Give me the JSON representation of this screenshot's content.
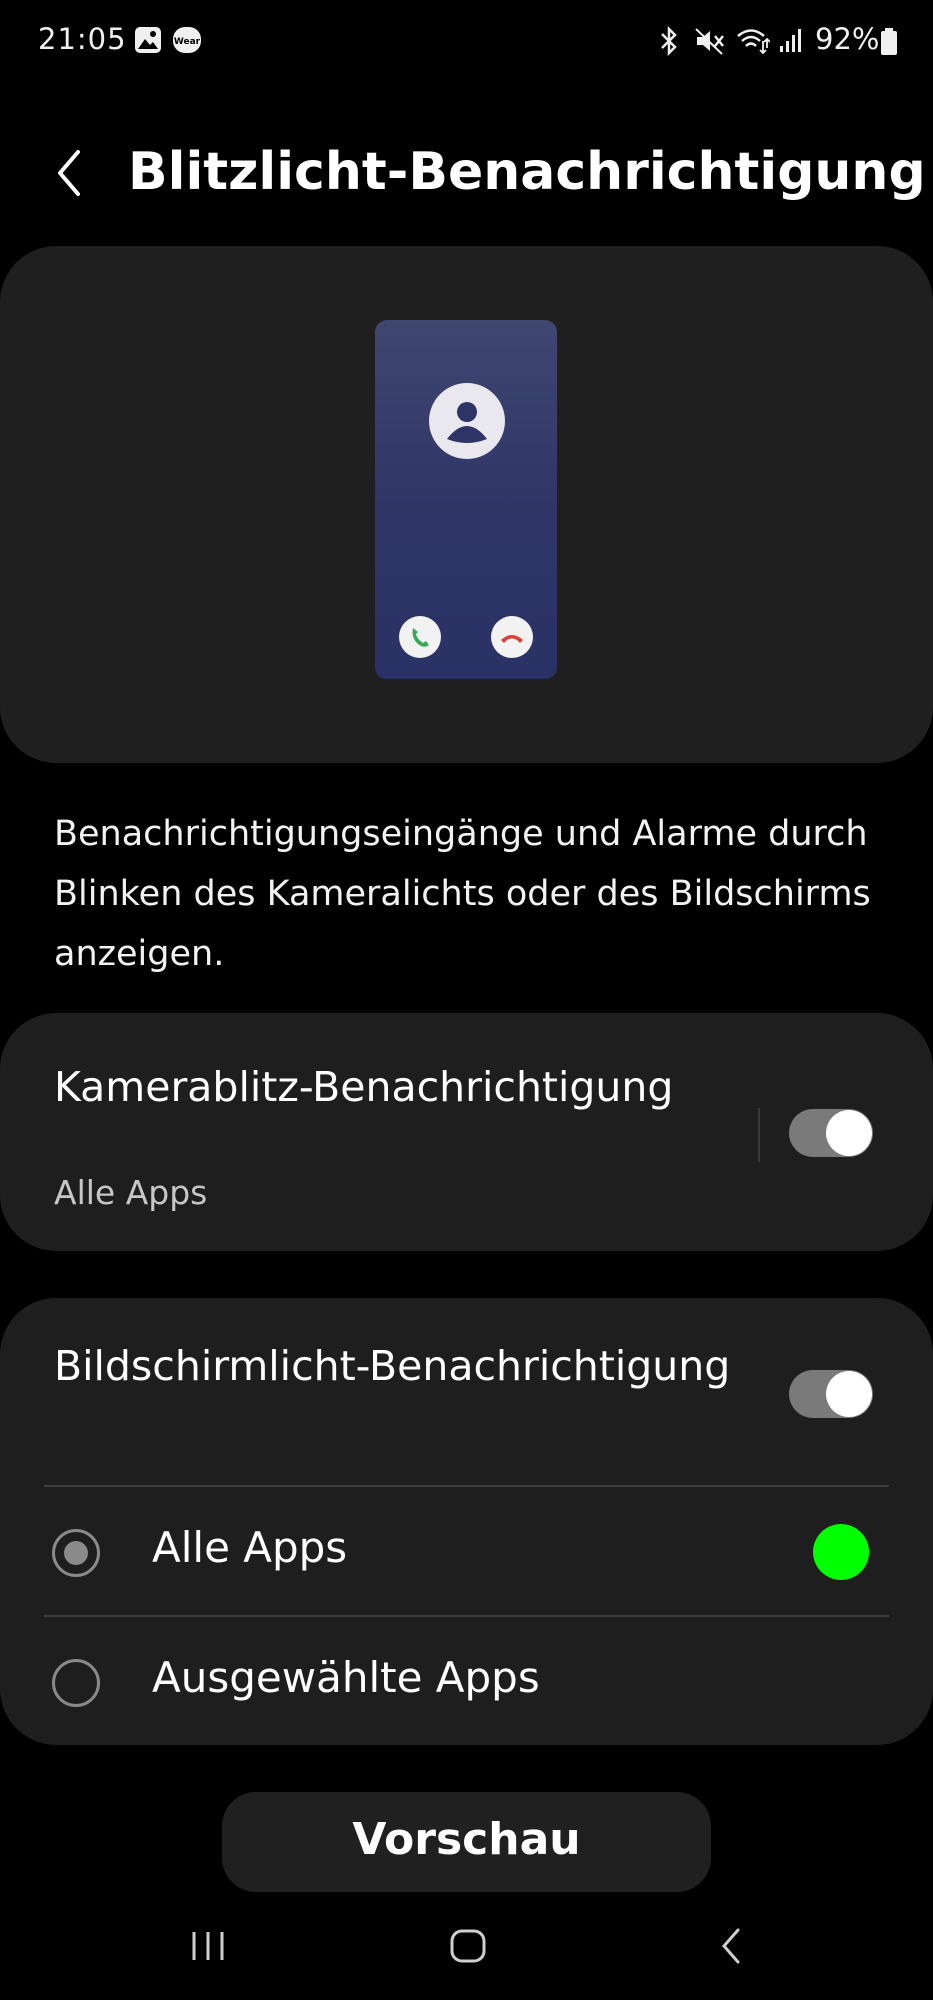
{
  "status_bar": {
    "time": "21:05",
    "left_icons": [
      "gallery-icon",
      "wear-icon"
    ],
    "wear_label": "Wear",
    "right_icons": [
      "bluetooth-icon",
      "mute-icon",
      "wifi-icon",
      "signal-icon"
    ],
    "battery": "92%"
  },
  "header": {
    "title": "Blitzlicht-Benachrichtigung"
  },
  "description": "Benachrichtigungseingänge und Alarme durch Blinken des Kameralichts oder des Bildschirms anzeigen.",
  "camera_flash": {
    "title": "Kamerablitz-Benachrichtigung",
    "subtitle": "Alle Apps",
    "enabled": true
  },
  "screen_flash": {
    "title": "Bildschirmlicht-Benachrichtigung",
    "enabled": true,
    "options": [
      {
        "label": "Alle Apps",
        "selected": true,
        "color": "#00ff00"
      },
      {
        "label": "Ausgewählte Apps",
        "selected": false
      }
    ]
  },
  "preview_button": "Vorschau",
  "nav_bar": [
    "recents-icon",
    "home-icon",
    "back-icon"
  ],
  "colors": {
    "accept_call": "#3aa85a",
    "decline_call": "#d9423a",
    "flash_color": "#00ff00"
  }
}
